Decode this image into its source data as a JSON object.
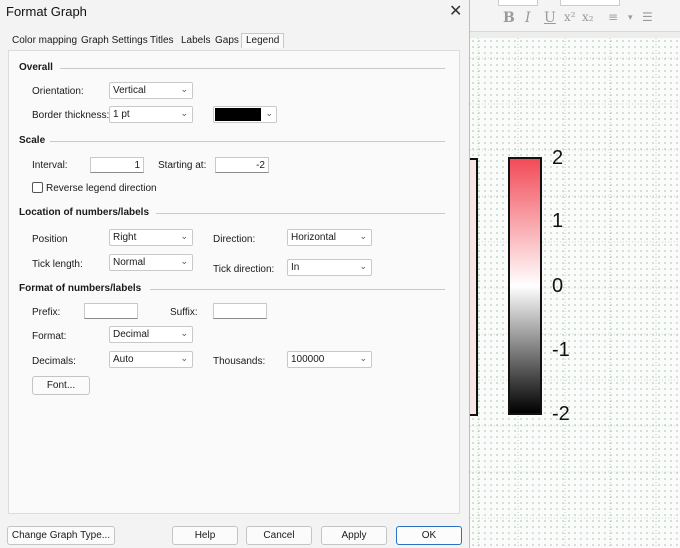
{
  "dialog": {
    "title": "Format Graph",
    "tabs": [
      "Color mapping",
      "Graph Settings",
      "Titles",
      "Labels",
      "Gaps",
      "Legend"
    ],
    "active_tab": "Legend"
  },
  "overall": {
    "heading": "Overall",
    "orientation_label": "Orientation:",
    "orientation_value": "Vertical",
    "border_label": "Border thickness:",
    "border_value": "1 pt",
    "border_color": "#000000"
  },
  "scale": {
    "heading": "Scale",
    "interval_label": "Interval:",
    "interval_value": "1",
    "starting_label": "Starting at:",
    "starting_value": "-2",
    "reverse_label": "Reverse legend direction",
    "reverse_checked": false
  },
  "location": {
    "heading": "Location of numbers/labels",
    "position_label": "Position",
    "position_value": "Right",
    "direction_label": "Direction:",
    "direction_value": "Horizontal",
    "ticklength_label": "Tick length:",
    "ticklength_value": "Normal",
    "tickdirection_label": "Tick direction:",
    "tickdirection_value": "In"
  },
  "format": {
    "heading": "Format of numbers/labels",
    "prefix_label": "Prefix:",
    "prefix_value": "",
    "suffix_label": "Suffix:",
    "suffix_value": "",
    "format_label": "Format:",
    "format_value": "Decimal",
    "decimals_label": "Decimals:",
    "decimals_value": "Auto",
    "thousands_label": "Thousands:",
    "thousands_value": "100000",
    "font_button": "Font..."
  },
  "footer": {
    "change_type": "Change Graph Type...",
    "help": "Help",
    "cancel": "Cancel",
    "apply": "Apply",
    "ok": "OK"
  },
  "background": {
    "toolbar_glyphs": [
      "B",
      "I",
      "U",
      "x²",
      "x₂"
    ],
    "legend_ticks": [
      "2",
      "1",
      "0",
      "-1",
      "-2"
    ],
    "legend_colors": [
      "#f24b57",
      "#ffffff",
      "#000000"
    ]
  }
}
